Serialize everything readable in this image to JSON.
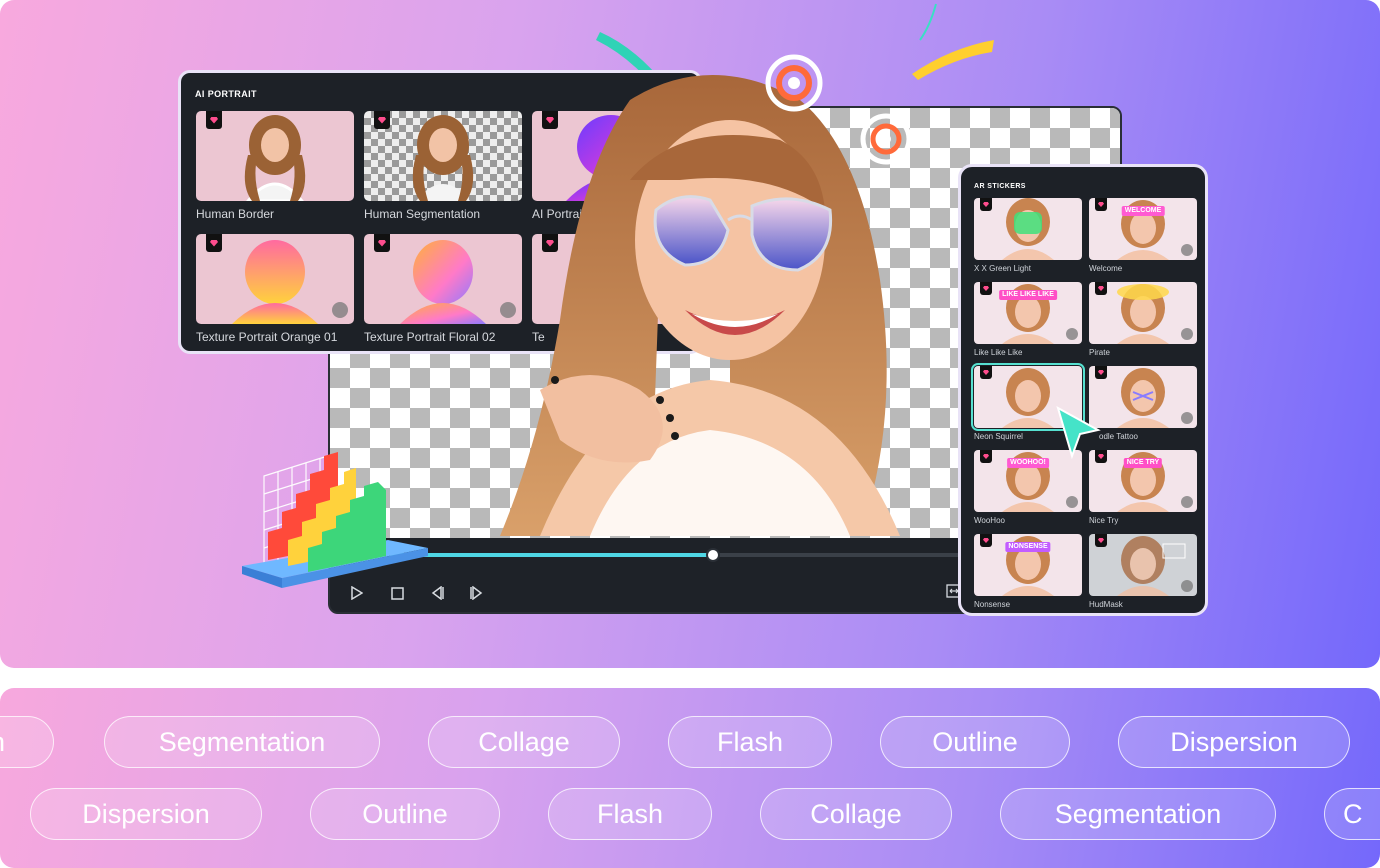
{
  "ai_portrait": {
    "title": "AI PORTRAIT",
    "items": [
      {
        "label": "Human Border",
        "premium": true,
        "download": false
      },
      {
        "label": "Human Segmentation",
        "premium": true,
        "download": false
      },
      {
        "label": "AI Portrait Gradient Ripp",
        "premium": true,
        "download": false
      },
      {
        "label": "Texture Portrait Orange 01",
        "premium": true,
        "download": true
      },
      {
        "label": "Texture Portrait Floral 02",
        "premium": true,
        "download": true
      },
      {
        "label": "Te",
        "premium": true,
        "download": false
      }
    ]
  },
  "ar_stickers": {
    "title": "AR STICKERS",
    "items": [
      {
        "label": "X X Green Light",
        "sticker": "",
        "color": "#3fe07a"
      },
      {
        "label": "Welcome",
        "sticker": "WELCOME",
        "color": "#ff5ad2"
      },
      {
        "label": "Like Like Like",
        "sticker": "LIKE LIKE LIKE",
        "color": "#ff4fc6"
      },
      {
        "label": "Pirate",
        "sticker": "",
        "color": "#ffd84a"
      },
      {
        "label": "Neon Squirrel",
        "sticker": "",
        "color": "#ff9a3c"
      },
      {
        "label": "Doodle Tattoo",
        "sticker": "",
        "color": "#8a7cff"
      },
      {
        "label": "WooHoo",
        "sticker": "WOOHOO!",
        "color": "#ff5ad2"
      },
      {
        "label": "Nice Try",
        "sticker": "NICE TRY",
        "color": "#ff4fc6"
      },
      {
        "label": "Nonsense",
        "sticker": "NONSENSE",
        "color": "#c35cff"
      },
      {
        "label": "HudMask",
        "sticker": "",
        "color": "#9aa3ad"
      }
    ],
    "selected": "Neon Squirrel",
    "selected_label_visible": "Neon Squirrel",
    "partial_label_visible": "odle Tattoo"
  },
  "player": {
    "progress": 0.44,
    "controls": [
      "play-icon",
      "stop-icon",
      "prev-frame-icon",
      "next-frame-icon",
      "fit-icon"
    ]
  },
  "tags": {
    "row1": [
      "n",
      "Segmentation",
      "Collage",
      "Flash",
      "Outline",
      "Dispersion"
    ],
    "row2": [
      "Dispersion",
      "Outline",
      "Flash",
      "Collage",
      "Segmentation",
      "C"
    ]
  },
  "colors": {
    "accent": "#4fd6e4",
    "panel_bg": "#1d2127",
    "premium": "#ff4d8d"
  }
}
